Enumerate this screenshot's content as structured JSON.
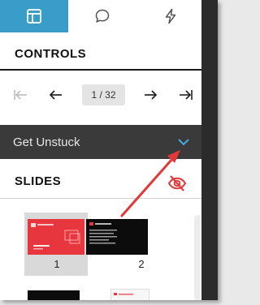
{
  "tabs": [
    {
      "icon": "layout-icon",
      "active": true
    },
    {
      "icon": "chat-bubble-icon",
      "active": false
    },
    {
      "icon": "lightning-bolt-icon",
      "active": false
    }
  ],
  "controls": {
    "title": "CONTROLS",
    "page_indicator": "1 / 32"
  },
  "get_unstuck": {
    "label": "Get Unstuck"
  },
  "slides": {
    "title": "SLIDES",
    "items": [
      {
        "number": "1",
        "selected": true
      },
      {
        "number": "2",
        "selected": false
      }
    ]
  },
  "colors": {
    "accent": "#3a9cc9",
    "unstuck_bar": "#3a3a3a",
    "annotation_arrow": "#e2383a",
    "slide1_bg": "#e8363f"
  }
}
